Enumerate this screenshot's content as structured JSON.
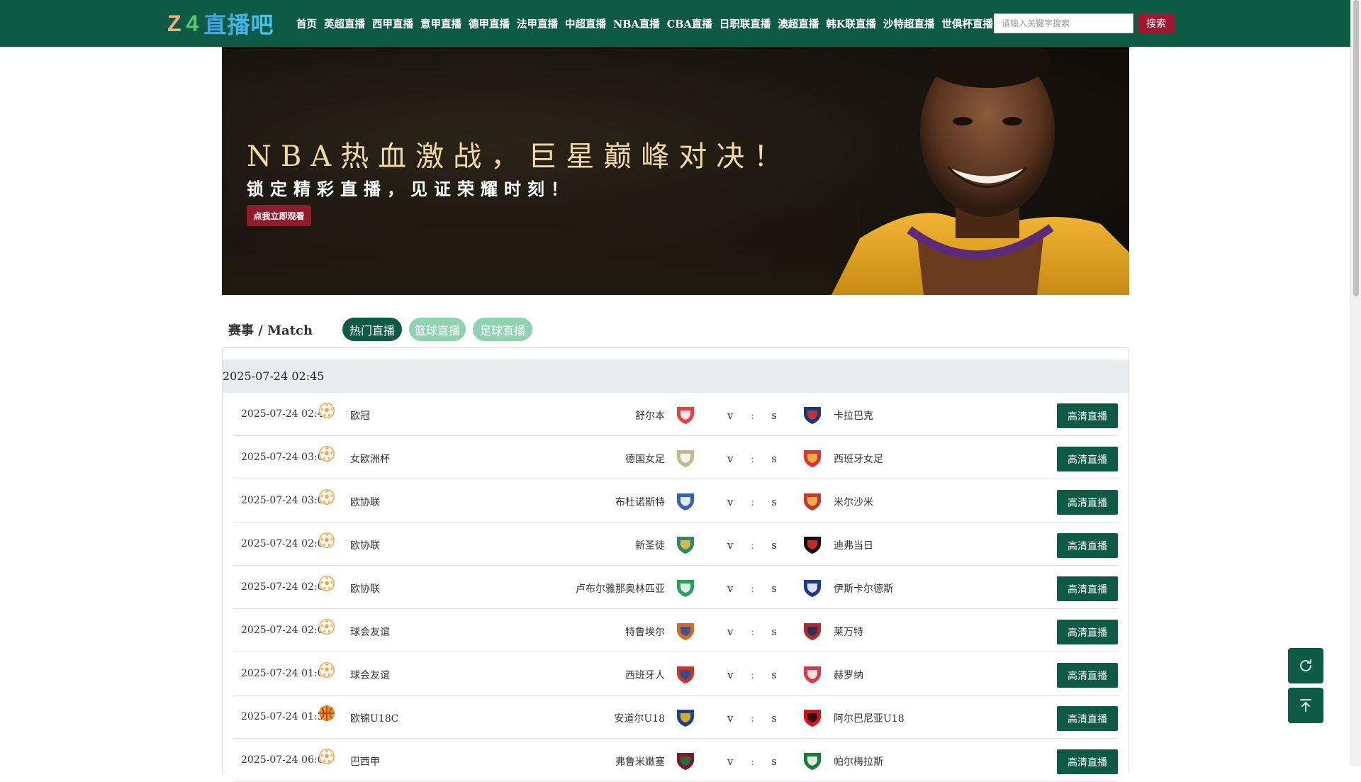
{
  "header": {
    "logo_z": "Z",
    "logo_4": "4",
    "logo_cn": "直播吧",
    "nav": [
      "首页",
      "英超直播",
      "西甲直播",
      "意甲直播",
      "德甲直播",
      "法甲直播",
      "中超直播",
      "NBA直播",
      "CBA直播",
      "日职联直播",
      "澳超直播",
      "韩K联直播",
      "沙特超直播",
      "世俱杯直播"
    ],
    "search_placeholder": "请输入关键字搜索",
    "search_button": "搜索"
  },
  "banner": {
    "title": "NBA热血激战，巨星巅峰对决！",
    "subtitle": "锁定精彩直播，见证荣耀时刻！",
    "button": "点我立即观看"
  },
  "matches_section": {
    "title": "赛事 / Match",
    "tabs": [
      "热门直播",
      "篮球直播",
      "足球直播"
    ],
    "active_tab": "热门直播",
    "date_header": "2025-07-24 02:45",
    "watch_label": "高清直播",
    "rows": [
      {
        "time": "2025-07-24 02:45",
        "sport": "football",
        "league": "欧冠",
        "home": "舒尔本",
        "away": "卡拉巴克",
        "v": "v",
        "colon": ":",
        "s": "s"
      },
      {
        "time": "2025-07-24 03:00",
        "sport": "football",
        "league": "女欧洲杯",
        "home": "德国女足",
        "away": "西班牙女足",
        "v": "v",
        "colon": ":",
        "s": "s"
      },
      {
        "time": "2025-07-24 03:00",
        "sport": "football",
        "league": "欧协联",
        "home": "布杜诺斯特",
        "away": "米尔沙米",
        "v": "v",
        "colon": ":",
        "s": "s"
      },
      {
        "time": "2025-07-24 02:00",
        "sport": "football",
        "league": "欧协联",
        "home": "新圣徒",
        "away": "迪弗当日",
        "v": "v",
        "colon": ":",
        "s": "s"
      },
      {
        "time": "2025-07-24 02:00",
        "sport": "football",
        "league": "欧协联",
        "home": "卢布尔雅那奥林匹亚",
        "away": "伊斯卡尔德斯",
        "v": "v",
        "colon": ":",
        "s": "s"
      },
      {
        "time": "2025-07-24 02:00",
        "sport": "football",
        "league": "球会友谊",
        "home": "特鲁埃尔",
        "away": "莱万特",
        "v": "v",
        "colon": ":",
        "s": "s"
      },
      {
        "time": "2025-07-24 01:00",
        "sport": "football",
        "league": "球会友谊",
        "home": "西班牙人",
        "away": "赫罗纳",
        "v": "v",
        "colon": ":",
        "s": "s"
      },
      {
        "time": "2025-07-24 01:30",
        "sport": "basketball",
        "league": "欧锦U18C",
        "home": "安道尔U18",
        "away": "阿尔巴尼亚U18",
        "v": "v",
        "colon": ":",
        "s": "s"
      },
      {
        "time": "2025-07-24 06:00",
        "sport": "football",
        "league": "巴西甲",
        "home": "弗鲁米嫩塞",
        "away": "帕尔梅拉斯",
        "v": "v",
        "colon": ":",
        "s": "s"
      }
    ]
  },
  "colors": {
    "primary": "#0f5a45",
    "accent": "#9b1832",
    "tab_inactive": "#8fd3b3"
  },
  "icons": {
    "football": "football-icon",
    "basketball": "basketball-icon",
    "refresh": "refresh-icon",
    "back_to_top": "arrow-up-icon"
  }
}
